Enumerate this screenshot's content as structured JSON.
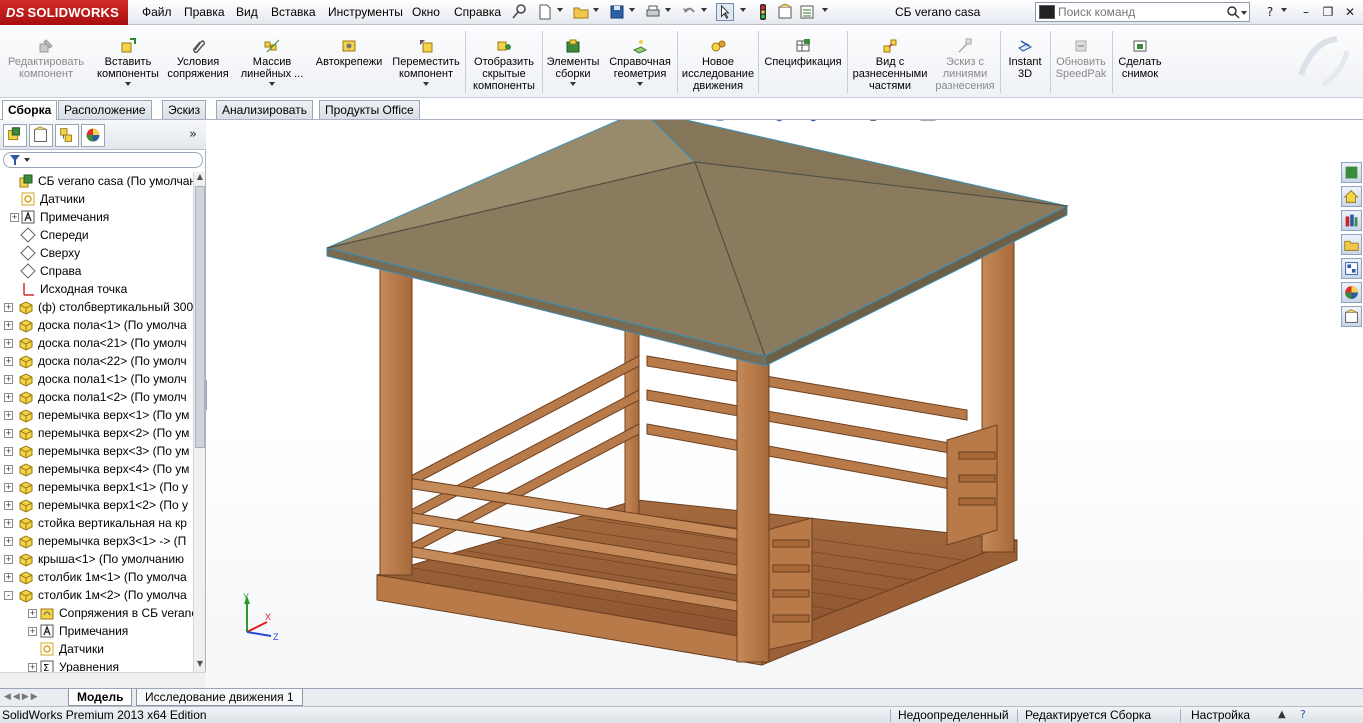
{
  "app": {
    "logo_text": "SOLIDWORKS",
    "logo_prefix": "DS",
    "document_title": "СБ verano casa"
  },
  "menu": [
    "Файл",
    "Правка",
    "Вид",
    "Вставка",
    "Инструменты",
    "Окно",
    "Справка"
  ],
  "search": {
    "placeholder": "Поиск команд"
  },
  "commands": [
    {
      "label": "Редактировать компонент",
      "disabled": true
    },
    {
      "label": "Вставить компоненты",
      "disabled": false
    },
    {
      "label": "Условия сопряжения",
      "disabled": false
    },
    {
      "label": "Массив линейных ...",
      "disabled": false
    },
    {
      "label": "Автокрепежи",
      "disabled": false
    },
    {
      "label": "Переместить компонент",
      "disabled": false
    },
    {
      "label": "Отобразить скрытые компоненты",
      "disabled": false
    },
    {
      "label": "Элементы сборки",
      "disabled": false
    },
    {
      "label": "Справочная геометрия",
      "disabled": false
    },
    {
      "label": "Новое исследование движения",
      "disabled": false
    },
    {
      "label": "Спецификация",
      "disabled": false
    },
    {
      "label": "Вид с разнесенными частями",
      "disabled": false
    },
    {
      "label": "Эскиз с линиями разнесения",
      "disabled": true
    },
    {
      "label": "Instant 3D",
      "disabled": false
    },
    {
      "label": "Обновить SpeedPak",
      "disabled": true
    },
    {
      "label": "Сделать снимок",
      "disabled": false
    }
  ],
  "tabs": [
    "Сборка",
    "Расположение",
    "Эскиз",
    "Анализировать",
    "Продукты Office"
  ],
  "tree": [
    {
      "label": "СБ verano casa  (По умолчанию<По умолчанию>)",
      "icon": "assembly-icon",
      "level": 0,
      "expander": ""
    },
    {
      "label": "Датчики",
      "icon": "sensors-icon",
      "level": 1,
      "expander": ""
    },
    {
      "label": "Примечания",
      "icon": "annotations-icon",
      "level": 1,
      "expander": "+"
    },
    {
      "label": "Спереди",
      "icon": "plane-icon",
      "level": 1,
      "expander": ""
    },
    {
      "label": "Сверху",
      "icon": "plane-icon",
      "level": 1,
      "expander": ""
    },
    {
      "label": "Справа",
      "icon": "plane-icon",
      "level": 1,
      "expander": ""
    },
    {
      "label": "Исходная точка",
      "icon": "origin-icon",
      "level": 1,
      "expander": ""
    },
    {
      "label": "(ф) столбвертикальный 300",
      "icon": "part-icon",
      "level": 0,
      "expander": "+"
    },
    {
      "label": "доска пола<1> (По умолча",
      "icon": "part-icon",
      "level": 0,
      "expander": "+"
    },
    {
      "label": "доска пола<21> (По умолч",
      "icon": "part-icon",
      "level": 0,
      "expander": "+"
    },
    {
      "label": "доска пола<22> (По умолч",
      "icon": "part-icon",
      "level": 0,
      "expander": "+"
    },
    {
      "label": "доска пола1<1> (По умолч",
      "icon": "part-icon",
      "level": 0,
      "expander": "+"
    },
    {
      "label": "доска пола1<2> (По умолч",
      "icon": "part-icon",
      "level": 0,
      "expander": "+"
    },
    {
      "label": "перемычка верх<1> (По ум",
      "icon": "part-icon",
      "level": 0,
      "expander": "+"
    },
    {
      "label": "перемычка верх<2> (По ум",
      "icon": "part-icon",
      "level": 0,
      "expander": "+"
    },
    {
      "label": "перемычка верх<3> (По ум",
      "icon": "part-icon",
      "level": 0,
      "expander": "+"
    },
    {
      "label": "перемычка верх<4> (По ум",
      "icon": "part-icon",
      "level": 0,
      "expander": "+"
    },
    {
      "label": "перемычка верх1<1> (По у",
      "icon": "part-icon",
      "level": 0,
      "expander": "+"
    },
    {
      "label": "перемычка верх1<2> (По у",
      "icon": "part-icon",
      "level": 0,
      "expander": "+"
    },
    {
      "label": "стойка вертикальная на кр",
      "icon": "part-icon",
      "level": 0,
      "expander": "+"
    },
    {
      "label": "перемычка верх3<1> -> (П",
      "icon": "part-icon",
      "level": 0,
      "expander": "+"
    },
    {
      "label": "крыша<1> (По умолчанию",
      "icon": "part-icon",
      "level": 0,
      "expander": "+"
    },
    {
      "label": "столбик 1м<1> (По умолча",
      "icon": "part-icon",
      "level": 0,
      "expander": "+"
    },
    {
      "label": "столбик 1м<2> (По умолча",
      "icon": "part-icon",
      "level": 0,
      "expander": "-"
    },
    {
      "label": "Сопряжения в СБ verano",
      "icon": "mates-icon",
      "level": 1,
      "expander": "+"
    },
    {
      "label": "Примечания",
      "icon": "annotations-icon",
      "level": 1,
      "expander": "+"
    },
    {
      "label": "Датчики",
      "icon": "sensors-icon",
      "level": 1,
      "expander": ""
    },
    {
      "label": "Уравнения",
      "icon": "equations-icon",
      "level": 1,
      "expander": "+"
    }
  ],
  "bottom_tabs": [
    "Модель",
    "Исследование движения 1"
  ],
  "status": {
    "edition": "SolidWorks Premium 2013 x64 Edition",
    "definition": "Недоопределенный",
    "editing": "Редактируется Сборка",
    "settings": "Настройка"
  },
  "triad": {
    "x": "X",
    "y": "Y",
    "z": "Z"
  },
  "colors": {
    "brand_red": "#c41e1e",
    "wood": "#b97a4a",
    "roof": "#8a7a5e"
  }
}
